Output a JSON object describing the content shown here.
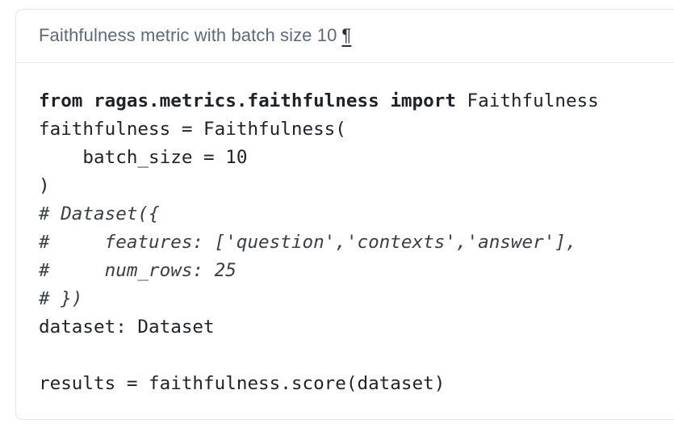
{
  "header": {
    "title": "Faithfulness metric with batch size 10",
    "anchor_symbol": "¶"
  },
  "code": {
    "line1": {
      "kw_from": "from",
      "module": "ragas.metrics.faithfulness",
      "kw_import": "import",
      "name": "Faithfulness"
    },
    "line2": "faithfulness = Faithfulness(",
    "line3": "    batch_size = 10",
    "line4": ")",
    "line5": "# Dataset({",
    "line6": "#     features: ['question','contexts','answer'],",
    "line7": "#     num_rows: 25",
    "line8": "# })",
    "line9": "dataset: Dataset",
    "line10": "",
    "line11": "results = faithfulness.score(dataset)"
  }
}
